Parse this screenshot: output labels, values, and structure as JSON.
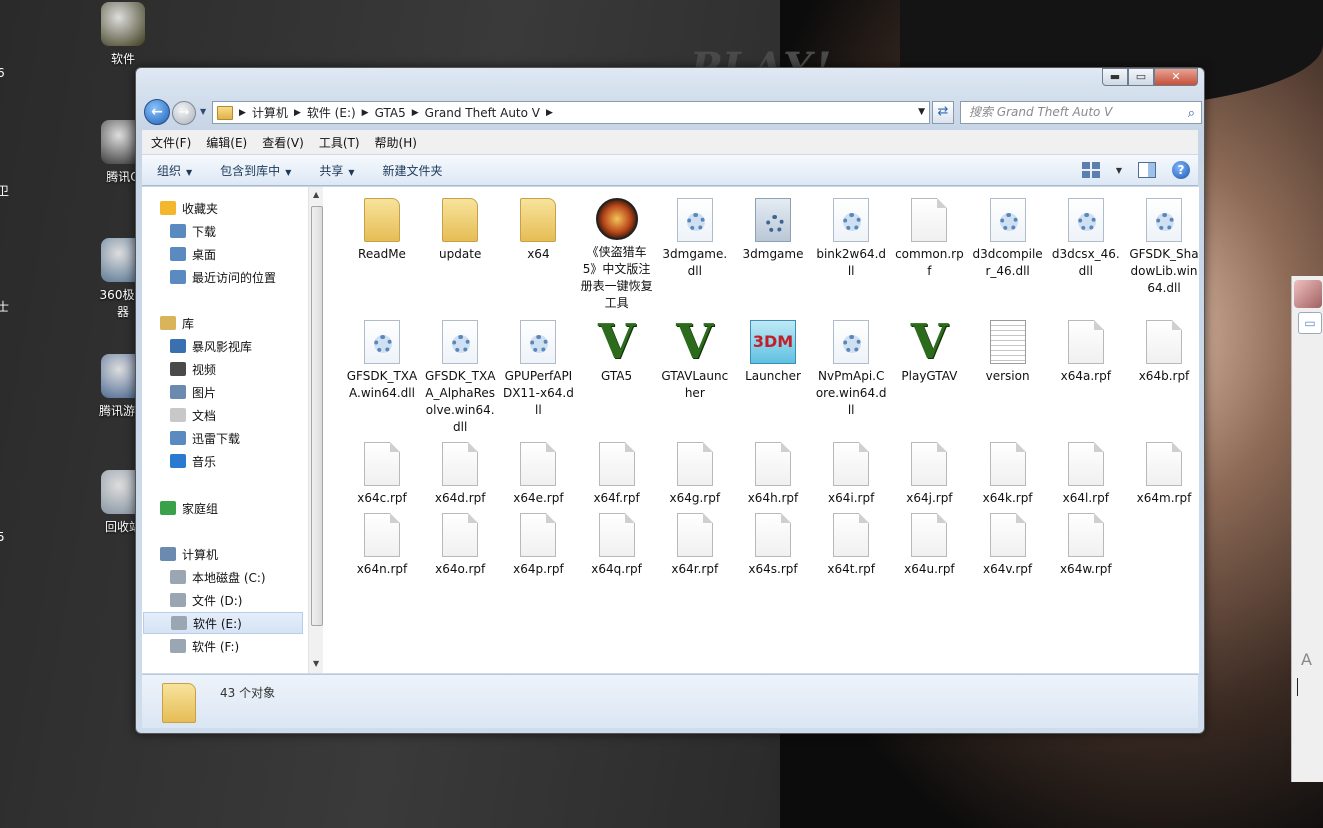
{
  "desktop": {
    "bg_text": "PLAY!",
    "icons": [
      {
        "label": "软件",
        "color": "#3a3a1a"
      },
      {
        "label": "腾讯Q",
        "color": "#222222"
      },
      {
        "label": "360极速\n器",
        "color": "#4a6a8a"
      },
      {
        "label": "腾讯游戏",
        "color": "#3a5a8a"
      },
      {
        "label": "回收站",
        "color": "#7a8a9a"
      }
    ],
    "left_edge_labels": [
      "6",
      "卫",
      "士",
      "5"
    ],
    "side_panel": {
      "a_label": "A"
    }
  },
  "window": {
    "caption_buttons": {
      "minimize": "▬",
      "maximize": "▭",
      "close": "✕"
    },
    "address": {
      "crumbs": [
        "计算机",
        "软件 (E:)",
        "GTA5",
        "Grand Theft Auto V"
      ]
    },
    "search_placeholder": "搜索 Grand Theft Auto V",
    "menu": [
      "文件(F)",
      "编辑(E)",
      "查看(V)",
      "工具(T)",
      "帮助(H)"
    ],
    "commands": [
      "组织",
      "包含到库中",
      "共享",
      "新建文件夹"
    ],
    "nav": {
      "favorites": "收藏夹",
      "fav_items": [
        "下载",
        "桌面",
        "最近访问的位置"
      ],
      "libraries": "库",
      "lib_items": [
        "暴风影视库",
        "视频",
        "图片",
        "文档",
        "迅雷下载",
        "音乐"
      ],
      "homegroup": "家庭组",
      "computer": "计算机",
      "drives": [
        "本地磁盘 (C:)",
        "文件 (D:)",
        "软件 (E:)",
        "软件 (F:)"
      ]
    },
    "files": [
      {
        "name": "ReadMe",
        "type": "folder"
      },
      {
        "name": "update",
        "type": "folder"
      },
      {
        "name": "x64",
        "type": "folder"
      },
      {
        "name": "《侠盗猎车5》中文版注册表一键恢复工具",
        "type": "badge"
      },
      {
        "name": "3dmgame.dll",
        "type": "dll"
      },
      {
        "name": "3dmgame",
        "type": "cfg"
      },
      {
        "name": "bink2w64.dll",
        "type": "dll"
      },
      {
        "name": "common.rpf",
        "type": "file"
      },
      {
        "name": "d3dcompiler_46.dll",
        "type": "dll"
      },
      {
        "name": "d3dcsx_46.dll",
        "type": "dll"
      },
      {
        "name": "GFSDK_ShadowLib.win64.dll",
        "type": "dll"
      },
      {
        "name": "GFSDK_TXAA.win64.dll",
        "type": "dll"
      },
      {
        "name": "GFSDK_TXAA_AlphaResolve.win64.dll",
        "type": "dll"
      },
      {
        "name": "GPUPerfAPIDX11-x64.dll",
        "type": "dll"
      },
      {
        "name": "GTA5",
        "type": "v"
      },
      {
        "name": "GTAVLauncher",
        "type": "v"
      },
      {
        "name": "Launcher",
        "type": "m3"
      },
      {
        "name": "NvPmApi.Core.win64.dll",
        "type": "dll"
      },
      {
        "name": "PlayGTAV",
        "type": "v"
      },
      {
        "name": "version",
        "type": "txt"
      },
      {
        "name": "x64a.rpf",
        "type": "file"
      },
      {
        "name": "x64b.rpf",
        "type": "file"
      },
      {
        "name": "x64c.rpf",
        "type": "file"
      },
      {
        "name": "x64d.rpf",
        "type": "file"
      },
      {
        "name": "x64e.rpf",
        "type": "file"
      },
      {
        "name": "x64f.rpf",
        "type": "file"
      },
      {
        "name": "x64g.rpf",
        "type": "file"
      },
      {
        "name": "x64h.rpf",
        "type": "file"
      },
      {
        "name": "x64i.rpf",
        "type": "file"
      },
      {
        "name": "x64j.rpf",
        "type": "file"
      },
      {
        "name": "x64k.rpf",
        "type": "file"
      },
      {
        "name": "x64l.rpf",
        "type": "file"
      },
      {
        "name": "x64m.rpf",
        "type": "file"
      },
      {
        "name": "x64n.rpf",
        "type": "file"
      },
      {
        "name": "x64o.rpf",
        "type": "file"
      },
      {
        "name": "x64p.rpf",
        "type": "file"
      },
      {
        "name": "x64q.rpf",
        "type": "file"
      },
      {
        "name": "x64r.rpf",
        "type": "file"
      },
      {
        "name": "x64s.rpf",
        "type": "file"
      },
      {
        "name": "x64t.rpf",
        "type": "file"
      },
      {
        "name": "x64u.rpf",
        "type": "file"
      },
      {
        "name": "x64v.rpf",
        "type": "file"
      },
      {
        "name": "x64w.rpf",
        "type": "file"
      }
    ],
    "status": "43 个对象",
    "colors": {
      "accent": "#1e395b",
      "selection": "#d5e3f5"
    }
  }
}
